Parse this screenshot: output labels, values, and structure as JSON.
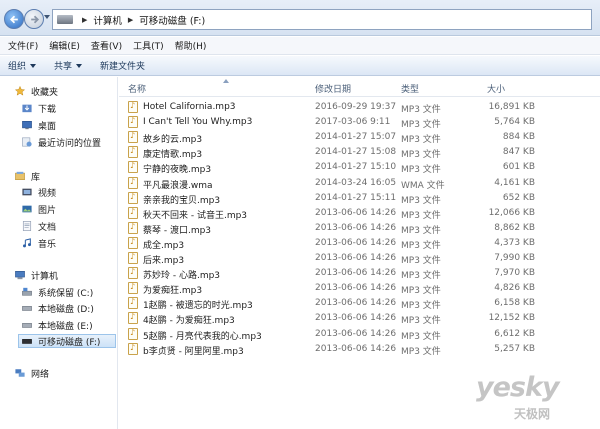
{
  "address": {
    "crumbs": [
      "计算机",
      "可移动磁盘 (F:)"
    ]
  },
  "menu": [
    "文件(F)",
    "编辑(E)",
    "查看(V)",
    "工具(T)",
    "帮助(H)"
  ],
  "commands": {
    "organize": "组织",
    "share": "共享",
    "new_folder": "新建文件夹"
  },
  "sidebar": {
    "favorites": "收藏夹",
    "fav_items": [
      "下载",
      "桌面",
      "最近访问的位置"
    ],
    "libraries": "库",
    "lib_items": [
      "视频",
      "图片",
      "文档",
      "音乐"
    ],
    "computer": "计算机",
    "drives": [
      "系统保留 (C:)",
      "本地磁盘 (D:)",
      "本地磁盘 (E:)",
      "可移动磁盘 (F:)"
    ],
    "network": "网络"
  },
  "columns": {
    "name": "名称",
    "date": "修改日期",
    "type": "类型",
    "size": "大小"
  },
  "files": [
    {
      "name": "Hotel California.mp3",
      "date": "2016-09-29 19:37",
      "type": "MP3 文件",
      "size": "16,891 KB"
    },
    {
      "name": "I Can't Tell You Why.mp3",
      "date": "2017-03-06 9:11",
      "type": "MP3 文件",
      "size": "5,764 KB"
    },
    {
      "name": "故乡的云.mp3",
      "date": "2014-01-27 15:07",
      "type": "MP3 文件",
      "size": "884 KB"
    },
    {
      "name": "康定情歌.mp3",
      "date": "2014-01-27 15:08",
      "type": "MP3 文件",
      "size": "847 KB"
    },
    {
      "name": "宁静的夜晚.mp3",
      "date": "2014-01-27 15:10",
      "type": "MP3 文件",
      "size": "601 KB"
    },
    {
      "name": "平凡最浪漫.wma",
      "date": "2014-03-24 16:05",
      "type": "WMA 文件",
      "size": "4,161 KB"
    },
    {
      "name": "亲亲我的宝贝.mp3",
      "date": "2014-01-27 15:11",
      "type": "MP3 文件",
      "size": "652 KB"
    },
    {
      "name": "秋天不回来 - 试音王.mp3",
      "date": "2013-06-06 14:26",
      "type": "MP3 文件",
      "size": "12,066 KB"
    },
    {
      "name": "蔡琴 - 渡口.mp3",
      "date": "2013-06-06 14:26",
      "type": "MP3 文件",
      "size": "8,862 KB"
    },
    {
      "name": "成全.mp3",
      "date": "2013-06-06 14:26",
      "type": "MP3 文件",
      "size": "4,373 KB"
    },
    {
      "name": "后来.mp3",
      "date": "2013-06-06 14:26",
      "type": "MP3 文件",
      "size": "7,990 KB"
    },
    {
      "name": "苏妙玲 - 心路.mp3",
      "date": "2013-06-06 14:26",
      "type": "MP3 文件",
      "size": "7,970 KB"
    },
    {
      "name": "为爱痴狂.mp3",
      "date": "2013-06-06 14:26",
      "type": "MP3 文件",
      "size": "4,826 KB"
    },
    {
      "name": "1赵鹏 - 被遗忘的时光.mp3",
      "date": "2013-06-06 14:26",
      "type": "MP3 文件",
      "size": "6,158 KB"
    },
    {
      "name": "4赵鹏 - 为爱痴狂.mp3",
      "date": "2013-06-06 14:26",
      "type": "MP3 文件",
      "size": "12,152 KB"
    },
    {
      "name": "5赵鹏 - 月亮代表我的心.mp3",
      "date": "2013-06-06 14:26",
      "type": "MP3 文件",
      "size": "6,612 KB"
    },
    {
      "name": "b李贞贤 - 阿里阿里.mp3",
      "date": "2013-06-06 14:26",
      "type": "MP3 文件",
      "size": "5,257 KB"
    }
  ],
  "watermark": {
    "main": "yesky",
    "sub": "天极网"
  }
}
